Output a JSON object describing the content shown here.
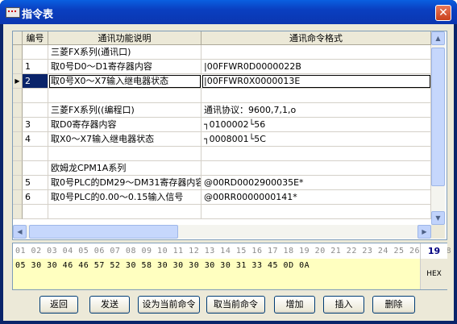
{
  "window": {
    "title": "指令表",
    "close_label": "✕"
  },
  "table": {
    "columns": [
      "编号",
      "通讯功能说明",
      "通讯命令格式"
    ],
    "rows": [
      {
        "num": "",
        "desc": "三菱FX系列(通讯口)",
        "cmd": ""
      },
      {
        "num": "1",
        "desc": "取0号D0～D1寄存器内容",
        "cmd": "|00FFWR0D0000022B"
      },
      {
        "num": "2",
        "desc": "取0号X0～X7输入继电器状态",
        "cmd": "|00FFWR0X0000013E"
      },
      {
        "num": "",
        "desc": "",
        "cmd": ""
      },
      {
        "num": "",
        "desc": "三菱FX系列((编程口)",
        "cmd": "通讯协议：9600,7,1,o"
      },
      {
        "num": "3",
        "desc": "取D0寄存器内容",
        "cmd": "┐0100002└56"
      },
      {
        "num": "4",
        "desc": "取X0～X7输入继电器状态",
        "cmd": "┐0008001└5C"
      },
      {
        "num": "",
        "desc": "",
        "cmd": ""
      },
      {
        "num": "",
        "desc": "欧姆龙CPM1A系列",
        "cmd": ""
      },
      {
        "num": "5",
        "desc": "取0号PLC的DM29～DM31寄存器内容",
        "cmd": "@00RD0002900035E*"
      },
      {
        "num": "6",
        "desc": "取0号PLC的0.00～0.15输入信号",
        "cmd": "@00RR0000000141*"
      },
      {
        "num": "",
        "desc": "",
        "cmd": ""
      }
    ],
    "current_row_marker": "▶"
  },
  "hex": {
    "ruler": "01 02 03 04 05 06 07 08 09 10 11 12 13 14 15 16 17 18 19 20 21 22 23 24 25 26 27 28",
    "data": "05 30 30 46 46 57 52 30 58 30 30 30 30 30 31 33 45 0D 0A",
    "count": "19",
    "mode": "HEX"
  },
  "buttons": {
    "back": "返回",
    "send": "发送",
    "set_current": "设为当前命令",
    "get_current": "取当前命令",
    "add": "增加",
    "insert": "插入",
    "delete": "删除"
  }
}
